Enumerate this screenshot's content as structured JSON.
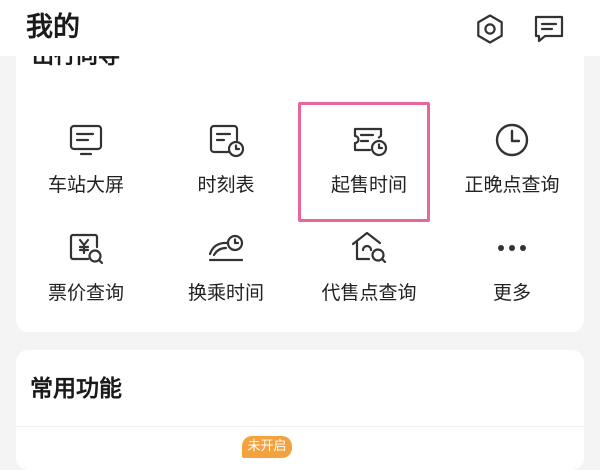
{
  "header": {
    "title": "我的",
    "settings_icon": "gear-icon",
    "message_icon": "message-icon"
  },
  "travel_guide": {
    "title": "出行向导",
    "items": [
      {
        "label": "车站大屏",
        "icon": "monitor-icon"
      },
      {
        "label": "时刻表",
        "icon": "timetable-icon"
      },
      {
        "label": "起售时间",
        "icon": "ticket-clock-icon",
        "highlighted": true
      },
      {
        "label": "正晚点查询",
        "icon": "clock-icon"
      },
      {
        "label": "票价查询",
        "icon": "price-search-icon"
      },
      {
        "label": "换乘时间",
        "icon": "transfer-clock-icon"
      },
      {
        "label": "代售点查询",
        "icon": "agent-search-icon"
      },
      {
        "label": "更多",
        "icon": "more-icon"
      }
    ]
  },
  "common_functions": {
    "title": "常用功能",
    "badge": "未开启"
  },
  "colors": {
    "highlight_border": "#e8669a",
    "badge_bg": "#f4a23e",
    "page_bg": "#f4f4f5"
  }
}
